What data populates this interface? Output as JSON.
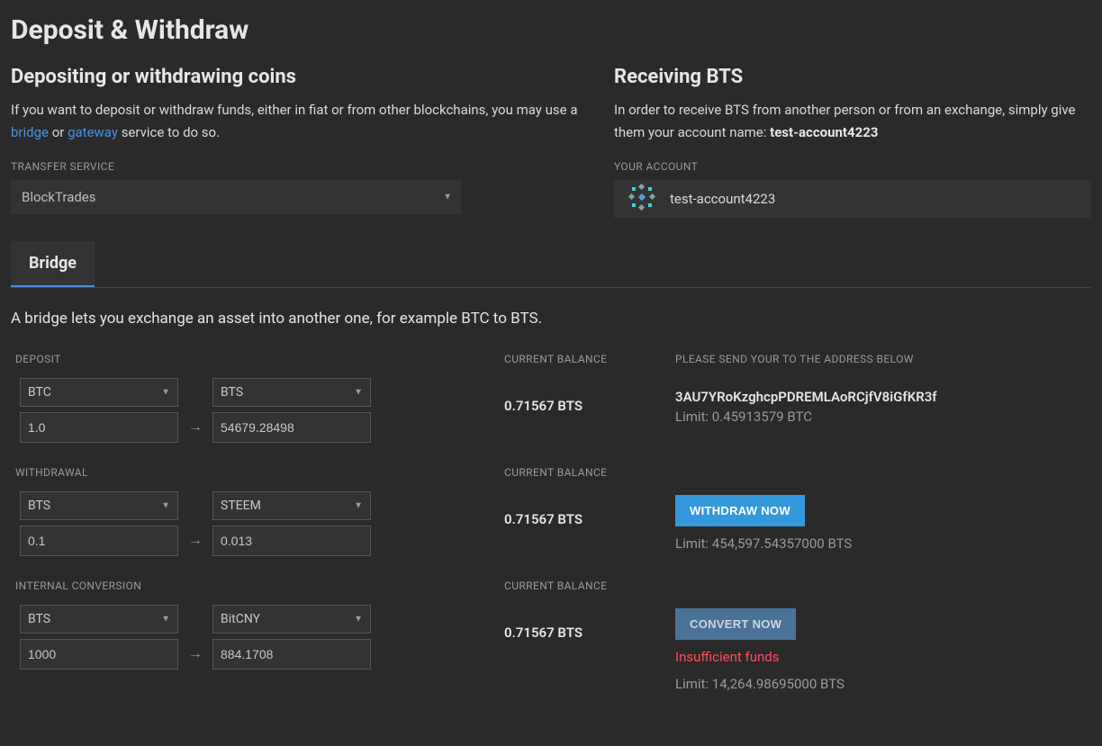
{
  "page_title": "Deposit & Withdraw",
  "left": {
    "heading": "Depositing or withdrawing coins",
    "intro_1": "If you want to deposit or withdraw funds, either in fiat or from other blockchains, you may use a ",
    "intro_bridge": "bridge",
    "intro_or": " or ",
    "intro_gateway": "gateway",
    "intro_2": " service to do so.",
    "transfer_label": "TRANSFER SERVICE",
    "transfer_value": "BlockTrades"
  },
  "right": {
    "heading": "Receiving BTS",
    "intro_1": "In order to receive BTS from another person or from an exchange, simply give them your account name: ",
    "account_name_bold": "test-account4223",
    "account_label": "YOUR ACCOUNT",
    "account_value": "test-account4223"
  },
  "tabs": {
    "bridge": "Bridge"
  },
  "tab_desc": "A bridge lets you exchange an asset into another one, for example BTC to BTS.",
  "columns": {
    "deposit": "DEPOSIT",
    "withdrawal": "WITHDRAWAL",
    "internal": "INTERNAL CONVERSION",
    "balance": "CURRENT BALANCE",
    "send_to": "PLEASE SEND YOUR TO THE ADDRESS BELOW"
  },
  "deposit": {
    "from_asset": "BTC",
    "from_amount": "1.0",
    "to_asset": "BTS",
    "to_amount": "54679.28498",
    "balance": "0.71567 BTS",
    "address": "3AU7YRoKzghcpPDREMLAoRCjfV8iGfKR3f",
    "limit": "Limit: 0.45913579 BTC"
  },
  "withdraw": {
    "from_asset": "BTS",
    "from_amount": "0.1",
    "to_asset": "STEEM",
    "to_amount": "0.013",
    "balance": "0.71567 BTS",
    "button": "WITHDRAW NOW",
    "limit": "Limit: 454,597.54357000 BTS"
  },
  "convert": {
    "from_asset": "BTS",
    "from_amount": "1000",
    "to_asset": "BitCNY",
    "to_amount": "884.1708",
    "balance": "0.71567 BTS",
    "button": "CONVERT NOW",
    "error": "Insufficient funds",
    "limit": "Limit: 14,264.98695000 BTS"
  }
}
